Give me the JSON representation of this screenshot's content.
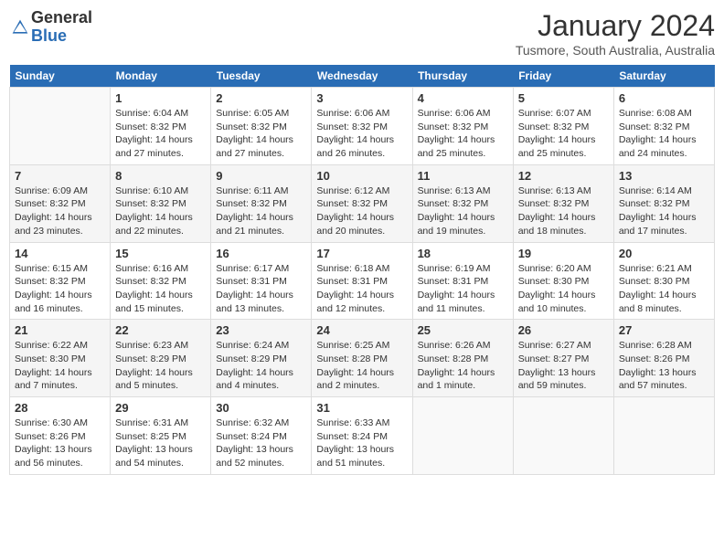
{
  "header": {
    "logo_general": "General",
    "logo_blue": "Blue",
    "title": "January 2024",
    "location": "Tusmore, South Australia, Australia"
  },
  "days_of_week": [
    "Sunday",
    "Monday",
    "Tuesday",
    "Wednesday",
    "Thursday",
    "Friday",
    "Saturday"
  ],
  "weeks": [
    [
      {
        "day": "",
        "info": ""
      },
      {
        "day": "1",
        "info": "Sunrise: 6:04 AM\nSunset: 8:32 PM\nDaylight: 14 hours\nand 27 minutes."
      },
      {
        "day": "2",
        "info": "Sunrise: 6:05 AM\nSunset: 8:32 PM\nDaylight: 14 hours\nand 27 minutes."
      },
      {
        "day": "3",
        "info": "Sunrise: 6:06 AM\nSunset: 8:32 PM\nDaylight: 14 hours\nand 26 minutes."
      },
      {
        "day": "4",
        "info": "Sunrise: 6:06 AM\nSunset: 8:32 PM\nDaylight: 14 hours\nand 25 minutes."
      },
      {
        "day": "5",
        "info": "Sunrise: 6:07 AM\nSunset: 8:32 PM\nDaylight: 14 hours\nand 25 minutes."
      },
      {
        "day": "6",
        "info": "Sunrise: 6:08 AM\nSunset: 8:32 PM\nDaylight: 14 hours\nand 24 minutes."
      }
    ],
    [
      {
        "day": "7",
        "info": "Sunrise: 6:09 AM\nSunset: 8:32 PM\nDaylight: 14 hours\nand 23 minutes."
      },
      {
        "day": "8",
        "info": "Sunrise: 6:10 AM\nSunset: 8:32 PM\nDaylight: 14 hours\nand 22 minutes."
      },
      {
        "day": "9",
        "info": "Sunrise: 6:11 AM\nSunset: 8:32 PM\nDaylight: 14 hours\nand 21 minutes."
      },
      {
        "day": "10",
        "info": "Sunrise: 6:12 AM\nSunset: 8:32 PM\nDaylight: 14 hours\nand 20 minutes."
      },
      {
        "day": "11",
        "info": "Sunrise: 6:13 AM\nSunset: 8:32 PM\nDaylight: 14 hours\nand 19 minutes."
      },
      {
        "day": "12",
        "info": "Sunrise: 6:13 AM\nSunset: 8:32 PM\nDaylight: 14 hours\nand 18 minutes."
      },
      {
        "day": "13",
        "info": "Sunrise: 6:14 AM\nSunset: 8:32 PM\nDaylight: 14 hours\nand 17 minutes."
      }
    ],
    [
      {
        "day": "14",
        "info": "Sunrise: 6:15 AM\nSunset: 8:32 PM\nDaylight: 14 hours\nand 16 minutes."
      },
      {
        "day": "15",
        "info": "Sunrise: 6:16 AM\nSunset: 8:32 PM\nDaylight: 14 hours\nand 15 minutes."
      },
      {
        "day": "16",
        "info": "Sunrise: 6:17 AM\nSunset: 8:31 PM\nDaylight: 14 hours\nand 13 minutes."
      },
      {
        "day": "17",
        "info": "Sunrise: 6:18 AM\nSunset: 8:31 PM\nDaylight: 14 hours\nand 12 minutes."
      },
      {
        "day": "18",
        "info": "Sunrise: 6:19 AM\nSunset: 8:31 PM\nDaylight: 14 hours\nand 11 minutes."
      },
      {
        "day": "19",
        "info": "Sunrise: 6:20 AM\nSunset: 8:30 PM\nDaylight: 14 hours\nand 10 minutes."
      },
      {
        "day": "20",
        "info": "Sunrise: 6:21 AM\nSunset: 8:30 PM\nDaylight: 14 hours\nand 8 minutes."
      }
    ],
    [
      {
        "day": "21",
        "info": "Sunrise: 6:22 AM\nSunset: 8:30 PM\nDaylight: 14 hours\nand 7 minutes."
      },
      {
        "day": "22",
        "info": "Sunrise: 6:23 AM\nSunset: 8:29 PM\nDaylight: 14 hours\nand 5 minutes."
      },
      {
        "day": "23",
        "info": "Sunrise: 6:24 AM\nSunset: 8:29 PM\nDaylight: 14 hours\nand 4 minutes."
      },
      {
        "day": "24",
        "info": "Sunrise: 6:25 AM\nSunset: 8:28 PM\nDaylight: 14 hours\nand 2 minutes."
      },
      {
        "day": "25",
        "info": "Sunrise: 6:26 AM\nSunset: 8:28 PM\nDaylight: 14 hours\nand 1 minute."
      },
      {
        "day": "26",
        "info": "Sunrise: 6:27 AM\nSunset: 8:27 PM\nDaylight: 13 hours\nand 59 minutes."
      },
      {
        "day": "27",
        "info": "Sunrise: 6:28 AM\nSunset: 8:26 PM\nDaylight: 13 hours\nand 57 minutes."
      }
    ],
    [
      {
        "day": "28",
        "info": "Sunrise: 6:30 AM\nSunset: 8:26 PM\nDaylight: 13 hours\nand 56 minutes."
      },
      {
        "day": "29",
        "info": "Sunrise: 6:31 AM\nSunset: 8:25 PM\nDaylight: 13 hours\nand 54 minutes."
      },
      {
        "day": "30",
        "info": "Sunrise: 6:32 AM\nSunset: 8:24 PM\nDaylight: 13 hours\nand 52 minutes."
      },
      {
        "day": "31",
        "info": "Sunrise: 6:33 AM\nSunset: 8:24 PM\nDaylight: 13 hours\nand 51 minutes."
      },
      {
        "day": "",
        "info": ""
      },
      {
        "day": "",
        "info": ""
      },
      {
        "day": "",
        "info": ""
      }
    ]
  ]
}
